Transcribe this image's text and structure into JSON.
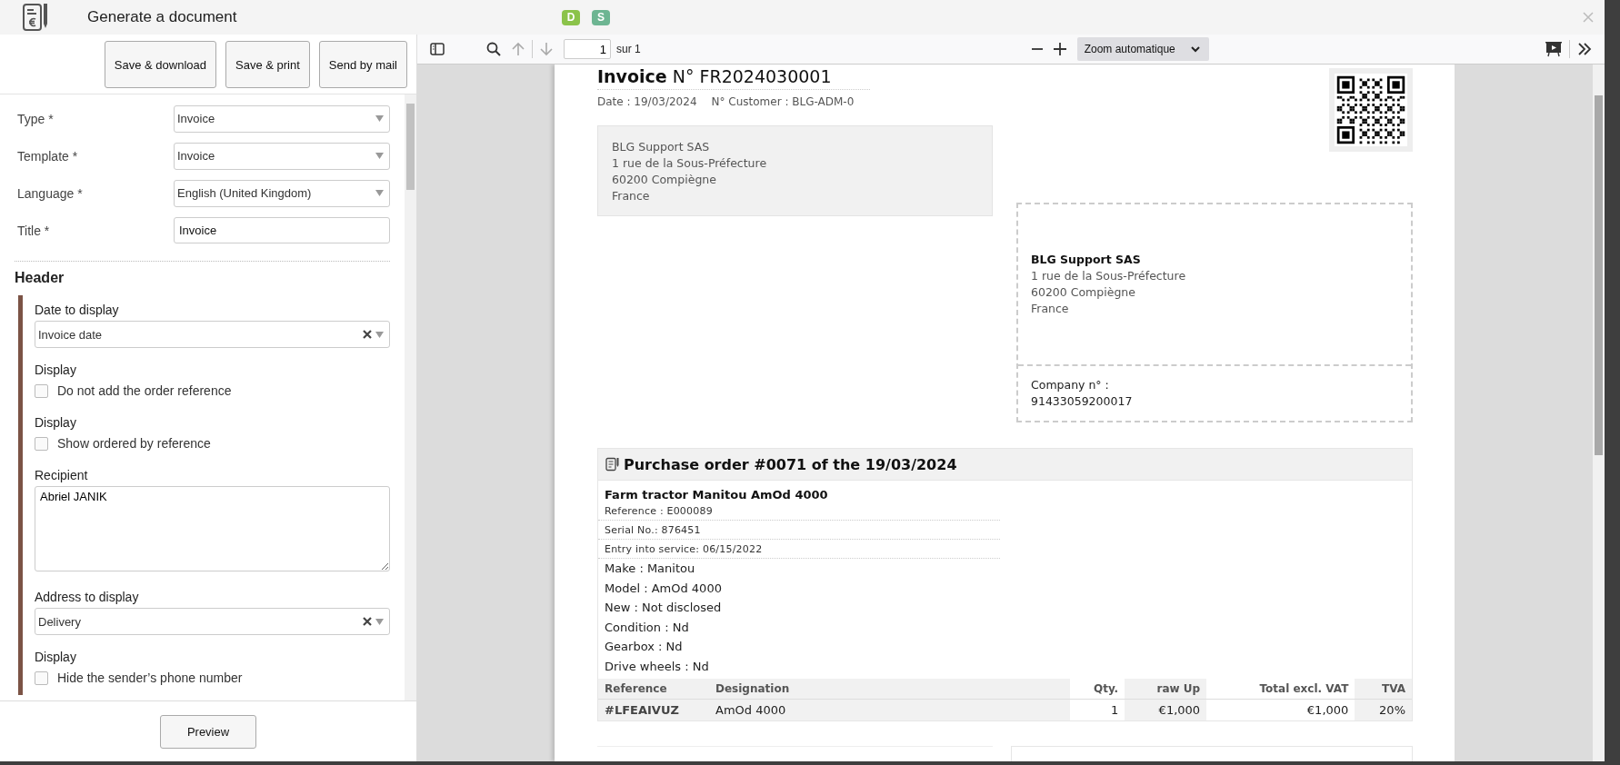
{
  "window": {
    "title": "Generate a document",
    "badges": [
      {
        "label": "D",
        "color": "#8bc34a"
      },
      {
        "label": "S",
        "color": "#6db592"
      }
    ]
  },
  "actions": [
    "Save & download",
    "Save & print",
    "Send by mail"
  ],
  "fields": [
    {
      "kind": "select",
      "label": "Type *",
      "value": "Invoice"
    },
    {
      "kind": "select",
      "label": "Template *",
      "value": "Invoice"
    },
    {
      "kind": "select",
      "label": "Language *",
      "value": "English (United Kingdom)"
    },
    {
      "kind": "text",
      "label": "Title *",
      "value": "Invoice"
    }
  ],
  "header_section": {
    "title": "Header",
    "items": [
      {
        "kind": "select",
        "label": "Date to display",
        "value": "Invoice date",
        "clearable": true
      },
      {
        "kind": "checkbox",
        "label": "Display",
        "option": "Do not add the order reference",
        "checked": false
      },
      {
        "kind": "checkbox",
        "label": "Display",
        "option": "Show ordered by reference",
        "checked": false
      },
      {
        "kind": "textarea",
        "label": "Recipient",
        "value": "Abriel JANIK"
      },
      {
        "kind": "select",
        "label": "Address to display",
        "value": "Delivery",
        "clearable": true
      },
      {
        "kind": "checkbox",
        "label": "Display",
        "option": "Hide the sender’s phone number",
        "checked": false
      }
    ]
  },
  "preview_button": "Preview",
  "viewer": {
    "page": "1",
    "page_count": "sur 1",
    "zoom": "Zoom automatique"
  },
  "document": {
    "title": "**Invoice** N° FR2024030001",
    "meta": [
      "Date : 19/03/2024",
      "N° Customer : BLG-ADM-0"
    ],
    "sender": [
      "BLG Support SAS",
      "1 rue de la Sous-Préfecture",
      "60200 Compiègne",
      "France"
    ],
    "recipient": [
      "BLG Support SAS",
      "1 rue de la Sous-Préfecture",
      "60200 Compiègne",
      "France"
    ],
    "company": [
      "Company n° :",
      "91433059200017"
    ],
    "order": {
      "title": "Purchase order #0071 of the 19/03/2024",
      "item_name": "Farm tractor Manitou AmOd 4000",
      "details": [
        "Reference : E000089",
        "Serial No.: 876451",
        "Entry into service: 06/15/2022"
      ],
      "attributes": [
        "Make : Manitou",
        "Model : AmOd 4000",
        "New : Not disclosed",
        "Condition : Nd",
        "Gearbox : Nd",
        "Drive wheels : Nd"
      ],
      "columns": [
        "Reference",
        "Designation",
        "Qty.",
        "raw Up",
        "Total excl. VAT",
        "TVA"
      ],
      "rows": [
        [
          "#LFEAIVUZ",
          "AmOd 4000",
          "1",
          "€1,000",
          "€1,000",
          "20%"
        ]
      ]
    }
  }
}
